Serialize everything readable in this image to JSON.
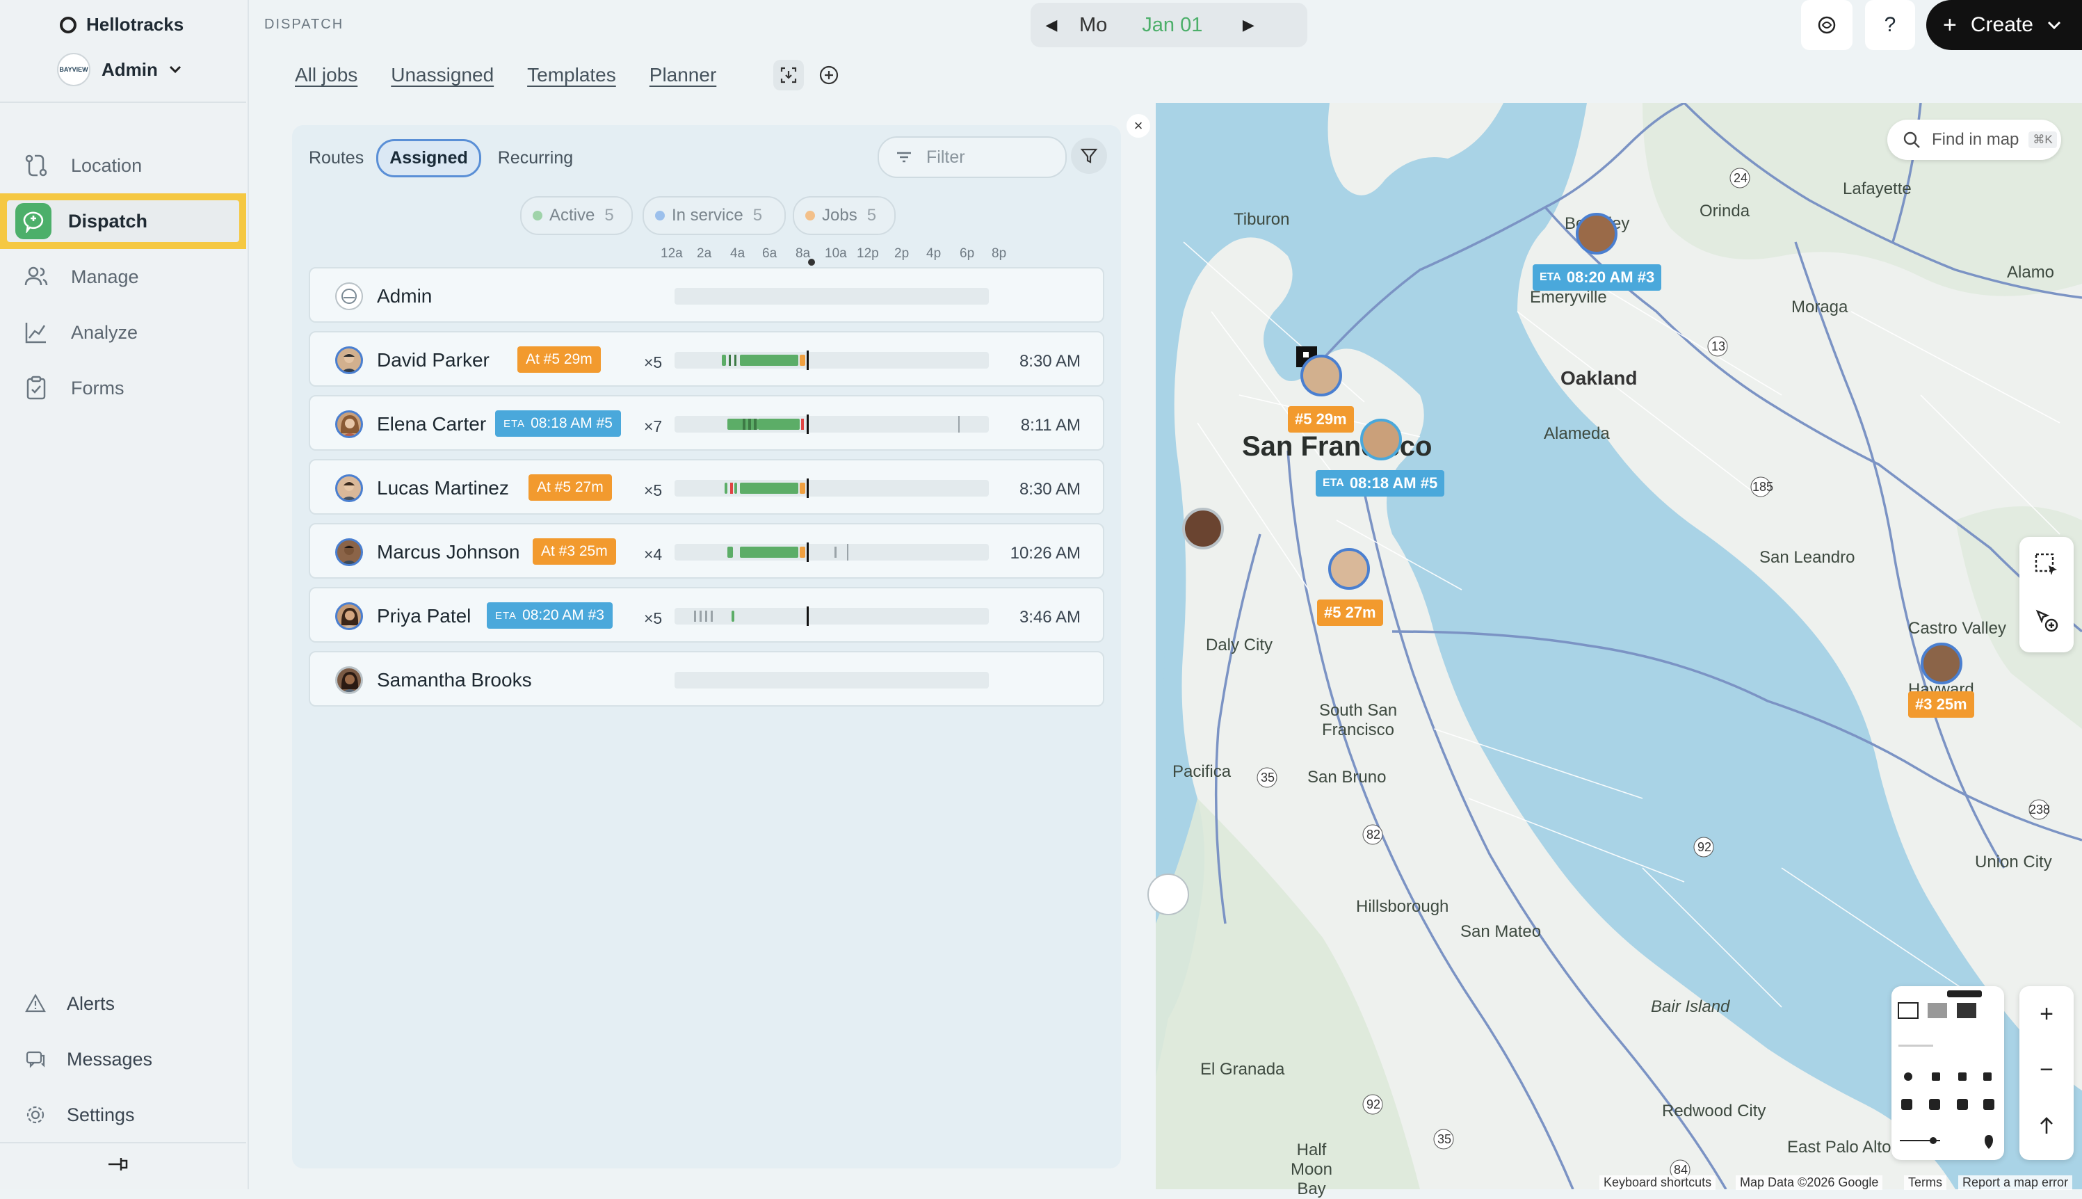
{
  "app": {
    "name": "Hellotracks",
    "account": "Admin",
    "account_logo_text": "BAYVIEW"
  },
  "nav": {
    "main": [
      {
        "label": "Location",
        "icon": "location-route-icon",
        "active": false
      },
      {
        "label": "Dispatch",
        "icon": "dispatch-icon",
        "active": true
      },
      {
        "label": "Manage",
        "icon": "manage-users-icon",
        "active": false
      },
      {
        "label": "Analyze",
        "icon": "analyze-chart-icon",
        "active": false
      },
      {
        "label": "Forms",
        "icon": "forms-clipboard-icon",
        "active": false
      }
    ],
    "bottom": [
      {
        "label": "Alerts",
        "icon": "alert-triangle-icon"
      },
      {
        "label": "Messages",
        "icon": "messages-icon"
      },
      {
        "label": "Settings",
        "icon": "gear-icon"
      }
    ]
  },
  "header": {
    "section": "DISPATCH",
    "day": "Mo",
    "date": "Jan 01",
    "create_label": "Create",
    "tabs": [
      "All jobs",
      "Unassigned",
      "Templates",
      "Planner"
    ]
  },
  "panel": {
    "segments": [
      "Routes",
      "Assigned",
      "Recurring"
    ],
    "selected_segment": "Assigned",
    "filter_placeholder": "Filter",
    "stats": [
      {
        "label": "Active",
        "count": "5",
        "color": "#9fd3a9"
      },
      {
        "label": "In service",
        "count": "5",
        "color": "#9cc0ec"
      },
      {
        "label": "Jobs",
        "count": "5",
        "color": "#f3c08a"
      }
    ],
    "hours": [
      "12a",
      "2a",
      "4a",
      "6a",
      "8a",
      "10a",
      "12p",
      "2p",
      "4p",
      "6p",
      "8p"
    ],
    "workers": [
      {
        "name": "Admin",
        "badge": "",
        "badge_type": "",
        "count": "",
        "time": ""
      },
      {
        "name": "David Parker",
        "badge": "At #5 29m",
        "badge_type": "at",
        "count": "×5",
        "time": "8:30 AM"
      },
      {
        "name": "Elena Carter",
        "badge": "08:18 AM #5",
        "badge_type": "eta",
        "count": "×7",
        "time": "8:11 AM"
      },
      {
        "name": "Lucas Martinez",
        "badge": "At #5 27m",
        "badge_type": "at",
        "count": "×5",
        "time": "8:30 AM"
      },
      {
        "name": "Marcus Johnson",
        "badge": "At #3 25m",
        "badge_type": "at",
        "count": "×4",
        "time": "10:26 AM"
      },
      {
        "name": "Priya Patel",
        "badge": "08:20 AM #3",
        "badge_type": "eta",
        "count": "×5",
        "time": "3:46 AM"
      },
      {
        "name": "Samantha Brooks",
        "badge": "",
        "badge_type": "",
        "count": "",
        "time": ""
      }
    ],
    "eta_prefix": "ETA"
  },
  "map": {
    "search_placeholder": "Find in map",
    "search_shortcut": "⌘K",
    "places": [
      "Tiburon",
      "Berkeley",
      "Orinda",
      "Lafayette",
      "Emeryville",
      "Moraga",
      "Alamo",
      "Oakland",
      "Alameda",
      "San Francisco",
      "Daly City",
      "South San Francisco",
      "San Bruno",
      "Pacifica",
      "San Leandro",
      "Castro Valley",
      "Hayward",
      "Union City",
      "Hillsborough",
      "San Mateo",
      "Bair Island",
      "El Granada",
      "Redwood City",
      "Half Moon Bay",
      "East Palo Alto"
    ],
    "markers": [
      {
        "badge": "08:20 AM #3",
        "type": "eta"
      },
      {
        "badge": "#5 29m",
        "type": "at"
      },
      {
        "badge": "08:18 AM #5",
        "type": "eta"
      },
      {
        "badge": "#5 27m",
        "type": "at"
      },
      {
        "badge": "#3 25m",
        "type": "at"
      }
    ],
    "footer": [
      "Keyboard shortcuts",
      "Map Data ©2026 Google",
      "Terms",
      "Report a map error"
    ]
  }
}
